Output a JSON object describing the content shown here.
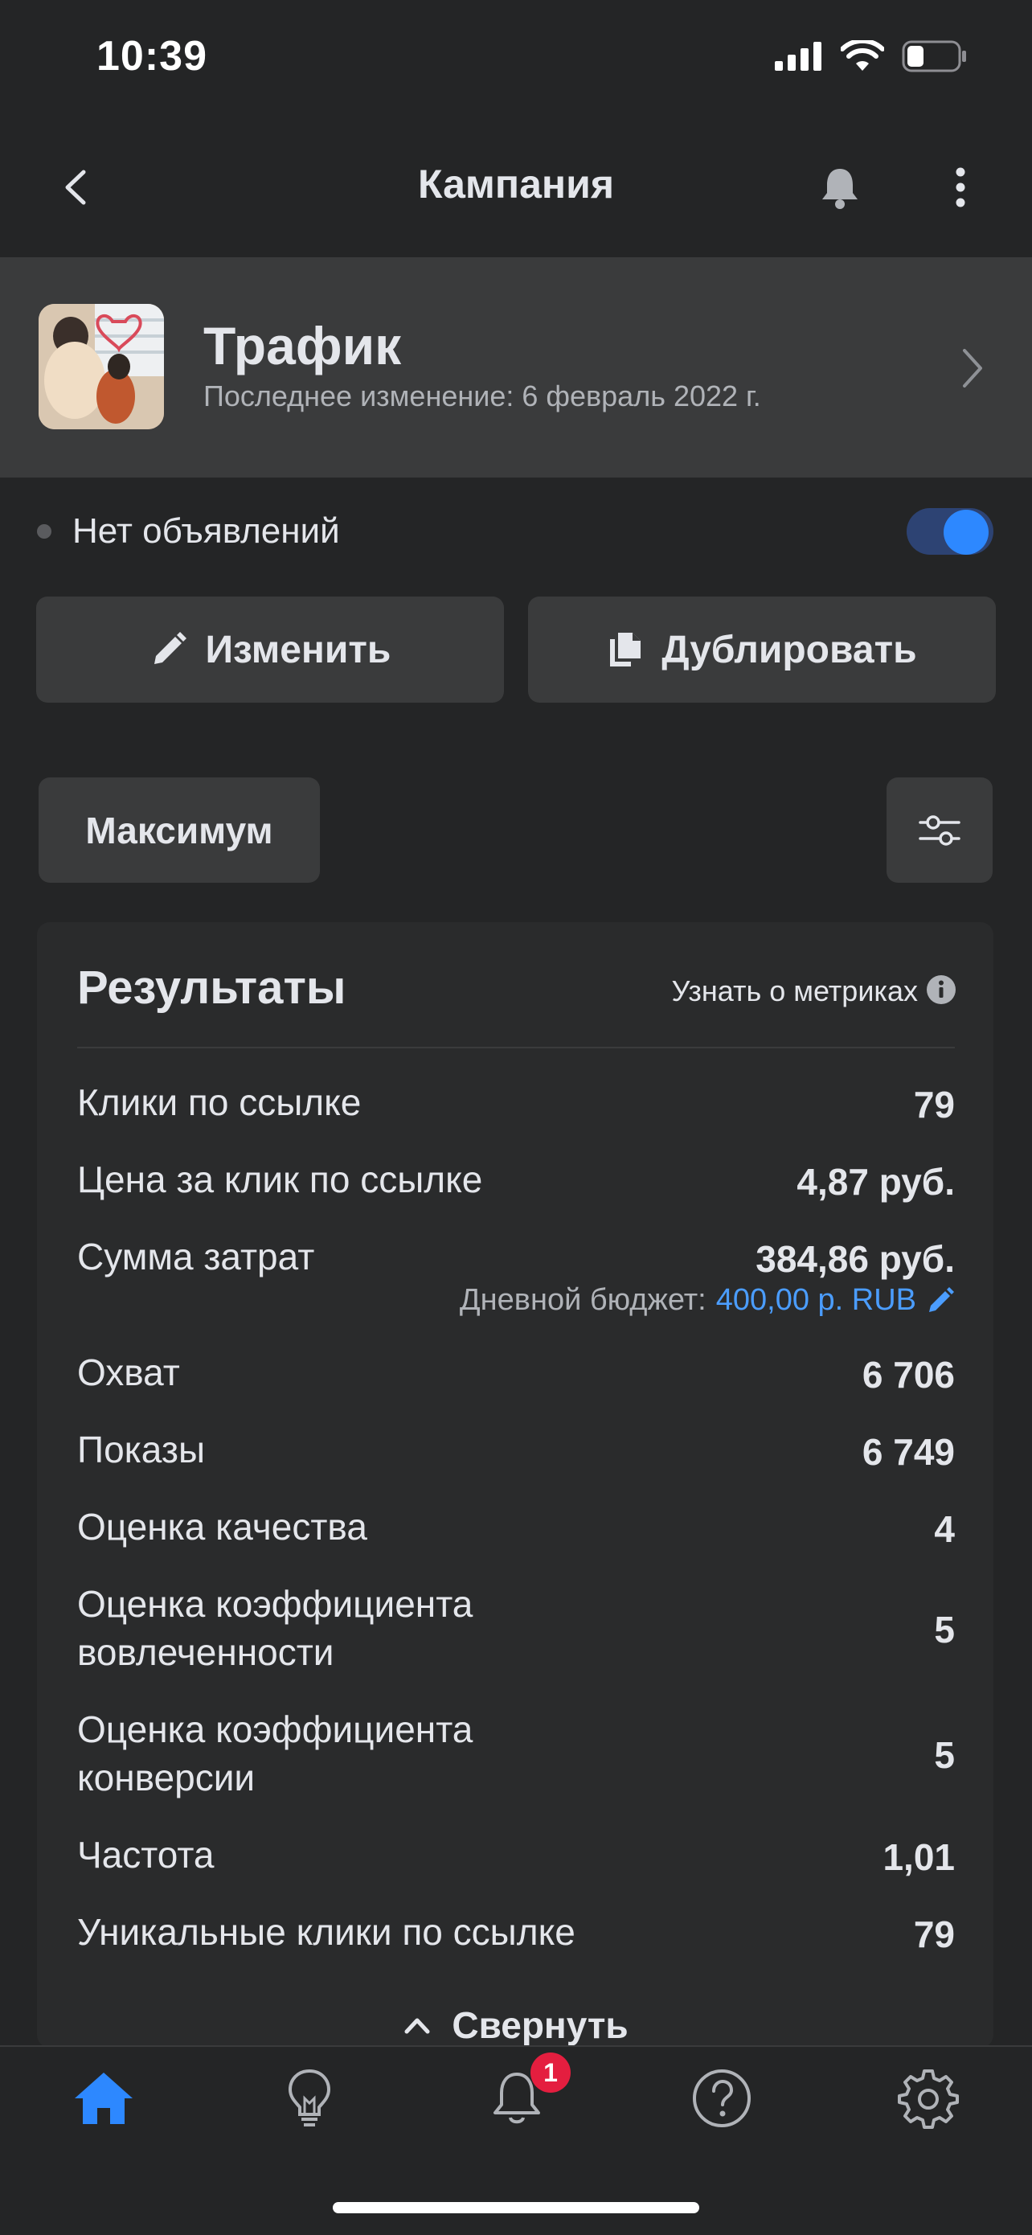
{
  "status_bar": {
    "time": "10:39"
  },
  "nav": {
    "title": "Кампания"
  },
  "campaign": {
    "name": "Трафик",
    "last_modified": "Последнее изменение: 6 февраль 2022 г."
  },
  "delivery": {
    "status": "Нет объявлений",
    "toggle_on": true
  },
  "actions": {
    "edit_label": "Изменить",
    "duplicate_label": "Дублировать"
  },
  "date_filter": {
    "label": "Максимум"
  },
  "results": {
    "title": "Результаты",
    "learn_link": "Узнать о метриках",
    "metrics": [
      {
        "label": "Клики по ссылке",
        "value": "79"
      },
      {
        "label": "Цена за клик по ссылке",
        "value": "4,87 руб."
      },
      {
        "label": "Сумма затрат",
        "value": "384,86 руб."
      },
      {
        "label": "Охват",
        "value": "6 706"
      },
      {
        "label": "Показы",
        "value": "6 749"
      },
      {
        "label": "Оценка качества",
        "value": "4"
      },
      {
        "label": "Оценка коэффициента вовлеченности",
        "value": "5"
      },
      {
        "label": "Оценка коэффициента конверсии",
        "value": "5"
      },
      {
        "label": "Частота",
        "value": "1,01"
      },
      {
        "label": "Уникальные клики по ссылке",
        "value": "79"
      }
    ],
    "budget_label": "Дневной бюджет:",
    "budget_value": "400,00 р. RUB",
    "collapse_label": "Свернуть"
  },
  "tabbar": {
    "items": [
      {
        "icon": "home-icon",
        "active": true
      },
      {
        "icon": "lightbulb-icon",
        "active": false
      },
      {
        "icon": "bell-icon",
        "active": false,
        "badge": "1"
      },
      {
        "icon": "help-icon",
        "active": false
      },
      {
        "icon": "gear-icon",
        "active": false
      }
    ]
  },
  "colors": {
    "accent": "#2d88ff",
    "link": "#4b9dff",
    "badge": "#e41e3f",
    "background": "#242526"
  }
}
